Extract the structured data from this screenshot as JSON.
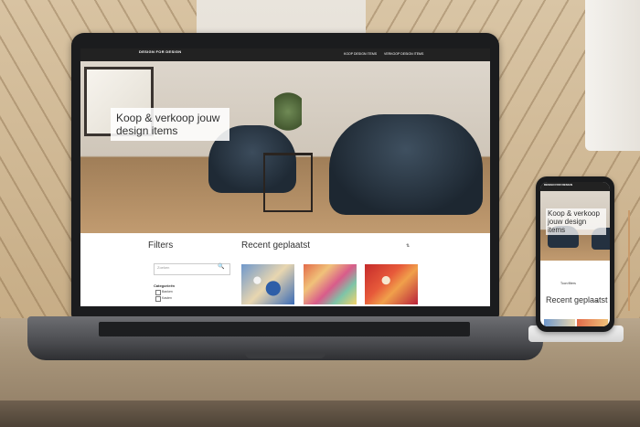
{
  "site": {
    "logo": "DESIGN FOR DESIGN",
    "nav": [
      "KOOP DESIGN ITEMS",
      "VERKOOP DESIGN ITEMS"
    ],
    "hero_title": "Koop & verkoop jouw design items",
    "filters_title": "Filters",
    "search_placeholder": "Zoeken",
    "categories_title": "Categorieën",
    "categories": [
      "Banken",
      "Kasten"
    ],
    "recent_title": "Recent geplaatst",
    "sort_label": "⇅"
  },
  "phone": {
    "logo": "DESIGN FOR DESIGN",
    "hero_title": "Koop & verkoop jouw design items",
    "filter_button": "Toon filters",
    "recent_title": "Recent geplaatst",
    "sort_label": "⇅"
  }
}
